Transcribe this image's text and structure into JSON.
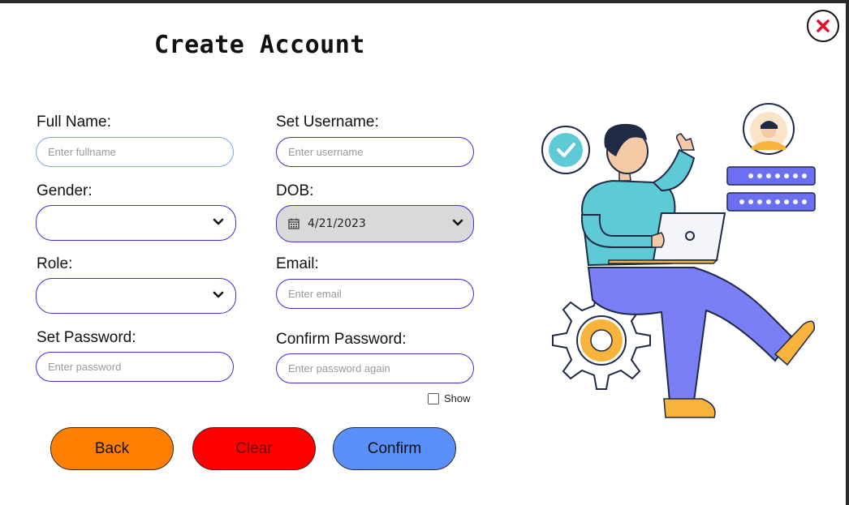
{
  "window": {
    "title": "Create Account"
  },
  "form": {
    "full_name": {
      "label": "Full Name:",
      "placeholder": "Enter fullname",
      "value": ""
    },
    "username": {
      "label": "Set Username:",
      "placeholder": "Enter username",
      "value": ""
    },
    "gender": {
      "label": "Gender:",
      "selected": ""
    },
    "dob": {
      "label": "DOB:",
      "value": "4/21/2023"
    },
    "role": {
      "label": "Role:",
      "selected": ""
    },
    "email": {
      "label": "Email:",
      "placeholder": "Enter email",
      "value": ""
    },
    "password": {
      "label": "Set Password:",
      "placeholder": "Enter password",
      "value": ""
    },
    "confirm_password": {
      "label": "Confirm Password:",
      "placeholder": "Enter password again",
      "value": ""
    },
    "show": {
      "label": "Show",
      "checked": false
    }
  },
  "buttons": {
    "back": "Back",
    "clear": "Clear",
    "confirm": "Confirm"
  },
  "colors": {
    "back": "#ff8000",
    "clear": "#ff0000",
    "confirm": "#5b8ff9",
    "field_border": "#3a2fd6",
    "close_x": "#e0102a"
  },
  "icons": [
    "close-icon",
    "chevron-down-icon",
    "calendar-icon",
    "checkmark-icon"
  ]
}
